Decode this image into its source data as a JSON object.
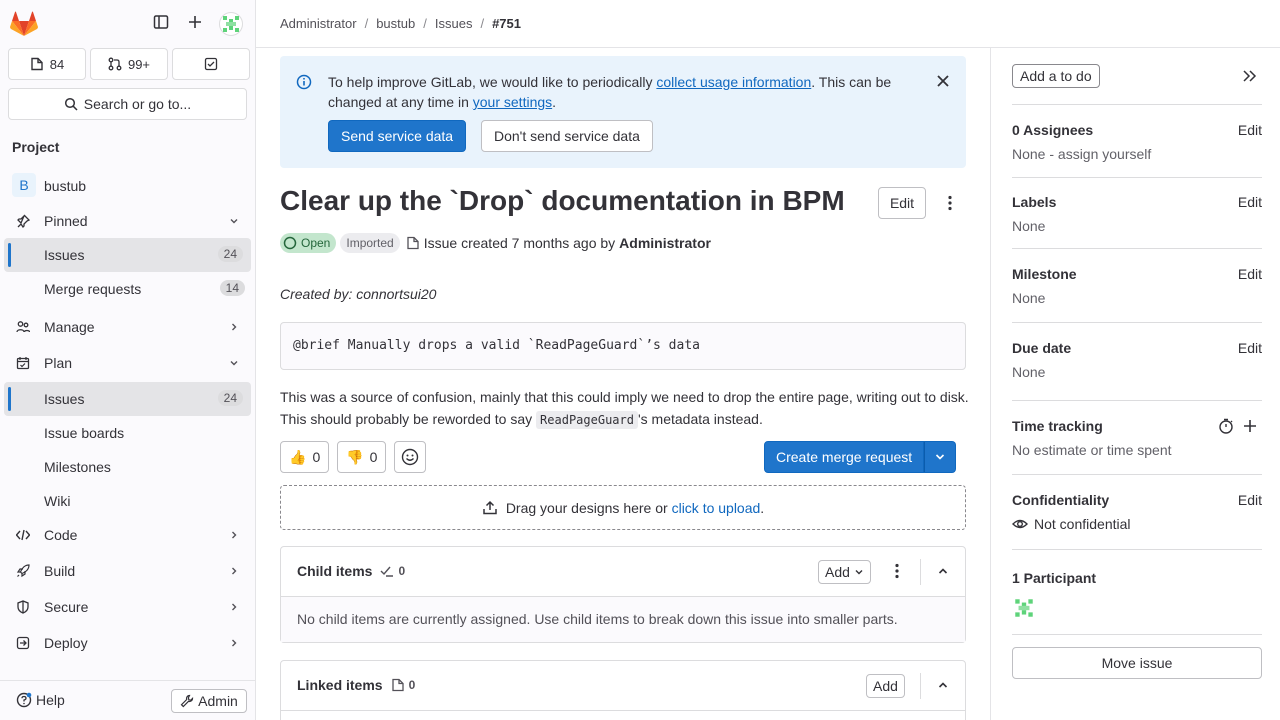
{
  "sidebar": {
    "counts": {
      "issues": "84",
      "merge_requests": "99+"
    },
    "search_label": "Search or go to...",
    "section_title": "Project",
    "project_initial": "B",
    "project_name": "bustub",
    "pinned_label": "Pinned",
    "pinned_items": [
      {
        "label": "Issues",
        "count": "24"
      },
      {
        "label": "Merge requests",
        "count": "14"
      }
    ],
    "manage_label": "Manage",
    "plan_label": "Plan",
    "plan_items": [
      {
        "label": "Issues",
        "count": "24"
      },
      {
        "label": "Issue boards"
      },
      {
        "label": "Milestones"
      },
      {
        "label": "Wiki"
      }
    ],
    "code_label": "Code",
    "build_label": "Build",
    "secure_label": "Secure",
    "deploy_label": "Deploy",
    "help_label": "Help",
    "admin_label": "Admin"
  },
  "breadcrumb": [
    "Administrator",
    "bustub",
    "Issues",
    "#751"
  ],
  "alert": {
    "text_before": "To help improve GitLab, we would like to periodically ",
    "link1": "collect usage information",
    "text_mid": ". This can be changed at any time in ",
    "link2": "your settings",
    "text_after": ".",
    "primary_button": "Send service data",
    "secondary_button": "Don't send service data"
  },
  "issue": {
    "title": "Clear up the `Drop` documentation in BPM",
    "edit_label": "Edit",
    "status": "Open",
    "imported": "Imported",
    "meta_text": "Issue created 7 months ago by",
    "author": "Administrator",
    "created_by": "Created by: connortsui20",
    "code": "@brief Manually drops a valid `ReadPageGuard`’s data",
    "para_before": "This was a source of confusion, mainly that this could imply we need to drop the entire page, writing out to disk. This should probably be reworded to say ",
    "para_code": "ReadPageGuard",
    "para_after": "'s metadata instead.",
    "thumbs_up": "0",
    "thumbs_down": "0",
    "create_mr": "Create merge request",
    "upload_text": "Drag your designs here or ",
    "upload_link": "click to upload",
    "upload_after": "."
  },
  "child_items": {
    "title": "Child items",
    "count": "0",
    "add_label": "Add",
    "empty": "No child items are currently assigned. Use child items to break down this issue into smaller parts."
  },
  "linked_items": {
    "title": "Linked items",
    "count": "0",
    "add_label": "Add"
  },
  "right": {
    "todo": "Add a to do",
    "assignees_label": "0 Assignees",
    "assignees_value": "None - assign yourself",
    "labels_label": "Labels",
    "labels_value": "None",
    "milestone_label": "Milestone",
    "milestone_value": "None",
    "due_label": "Due date",
    "due_value": "None",
    "time_label": "Time tracking",
    "time_value": "No estimate or time spent",
    "conf_label": "Confidentiality",
    "conf_value": "Not confidential",
    "participants_label": "1 Participant",
    "edit_label": "Edit",
    "move_issue": "Move issue"
  },
  "colors": {
    "accent": "#1f75cb",
    "open_badge_bg": "#c3e6cd",
    "alert_bg": "#e9f3fc"
  }
}
